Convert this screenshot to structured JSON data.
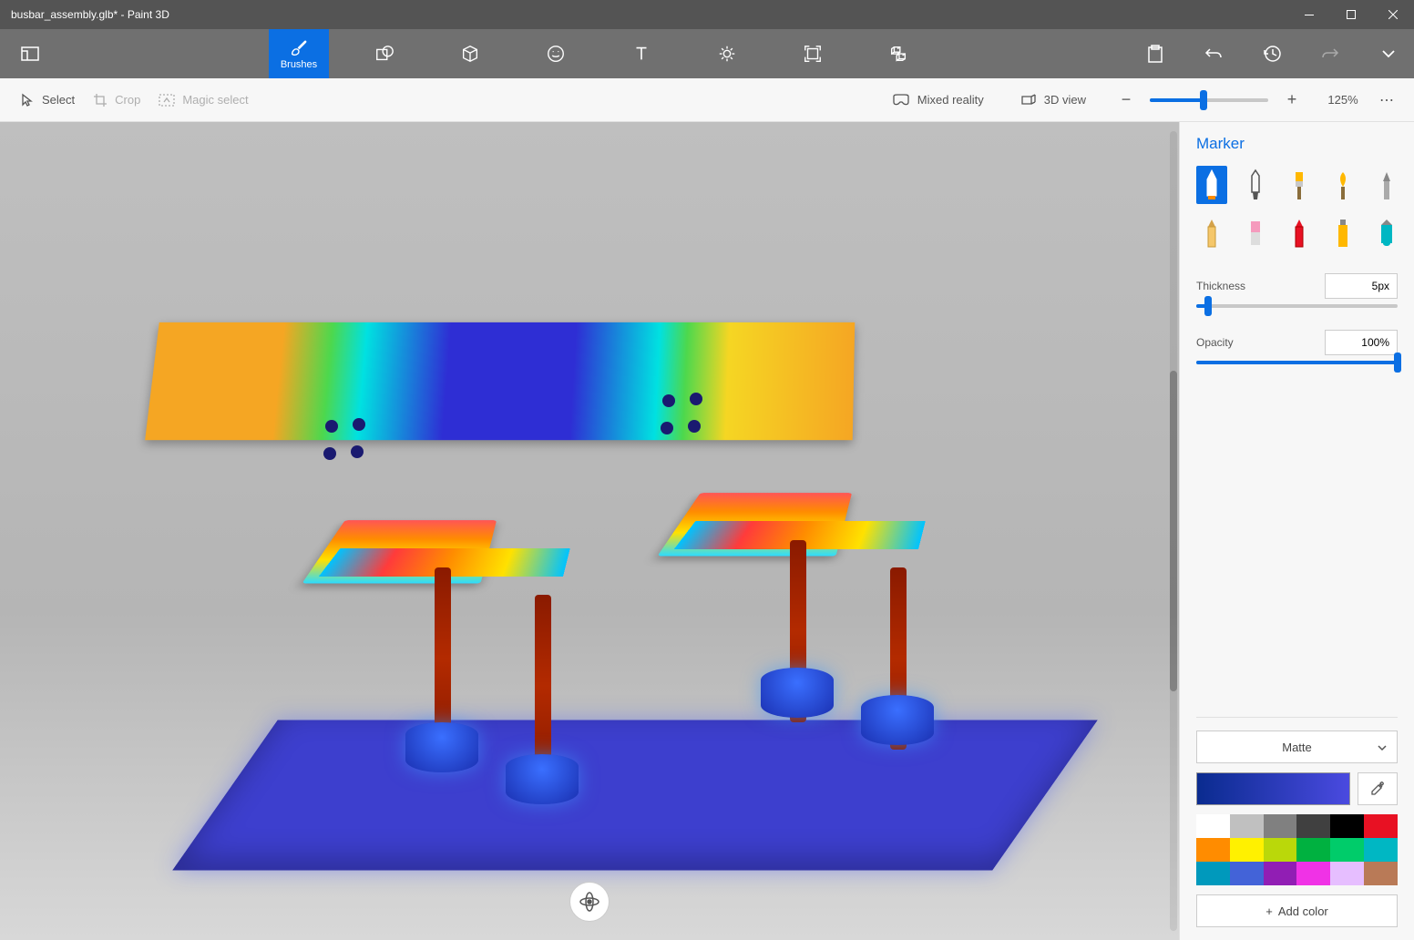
{
  "title": "busbar_assembly.glb* - Paint 3D",
  "ribbon": {
    "tabs": [
      {
        "id": "brushes",
        "label": "Brushes",
        "active": true
      },
      {
        "id": "2d",
        "label": ""
      },
      {
        "id": "3d",
        "label": ""
      },
      {
        "id": "stickers",
        "label": ""
      },
      {
        "id": "text",
        "label": ""
      },
      {
        "id": "effects",
        "label": ""
      },
      {
        "id": "canvas",
        "label": ""
      },
      {
        "id": "library",
        "label": ""
      }
    ]
  },
  "toolbar": {
    "select": "Select",
    "crop": "Crop",
    "magic_select": "Magic select",
    "mixed_reality": "Mixed reality",
    "view_3d": "3D view",
    "zoom_pct": "125%"
  },
  "sidepanel": {
    "title": "Marker",
    "thickness_label": "Thickness",
    "thickness_value": "5px",
    "thickness_pct": 6,
    "opacity_label": "Opacity",
    "opacity_value": "100%",
    "opacity_pct": 100,
    "material": "Matte",
    "add_color": "Add color",
    "brushes": [
      "marker",
      "calligraphy",
      "oil",
      "watercolor",
      "pixel",
      "pencil",
      "eraser",
      "crayon",
      "spray",
      "fill"
    ],
    "swatches_row1": [
      "#ffffff",
      "#c0c0c0",
      "#808080",
      "#404040",
      "#000000",
      "#e81123"
    ],
    "swatches_row2": [
      "#ff8c00",
      "#fff100",
      "#bad80a",
      "#00b140",
      "#00cc6a",
      "#00b7c3"
    ],
    "swatches_row3": [
      "#0099bc",
      "#4363d8",
      "#911eb4",
      "#f032e6",
      "#e6beff",
      "#b97a57"
    ]
  }
}
